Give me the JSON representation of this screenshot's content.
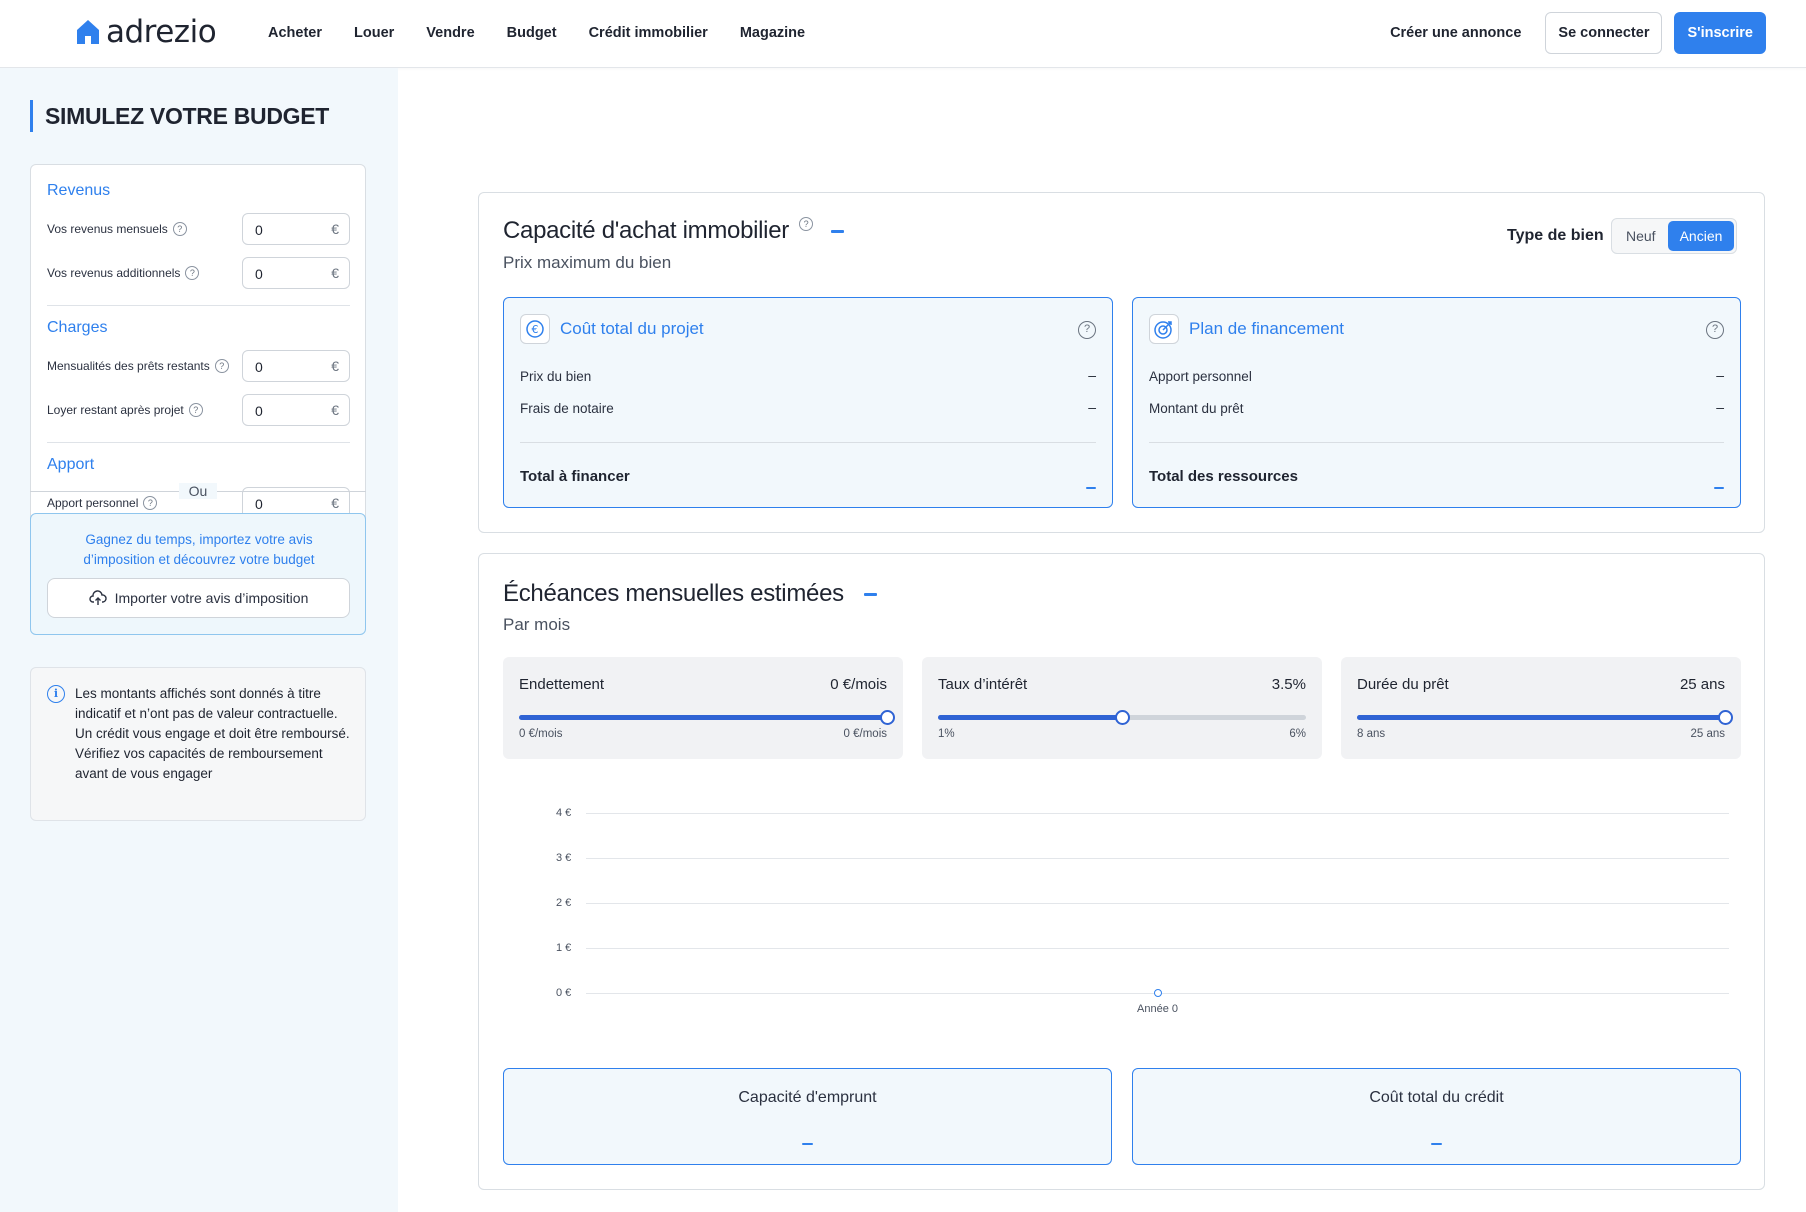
{
  "header": {
    "logo_text": "adrezio",
    "nav": [
      "Acheter",
      "Louer",
      "Vendre",
      "Budget",
      "Crédit immobilier",
      "Magazine"
    ],
    "create_listing": "Créer une annonce",
    "login": "Se connecter",
    "signup": "S'inscrire"
  },
  "sidebar": {
    "title": "SIMULEZ VOTRE BUDGET",
    "sections": {
      "revenus": "Revenus",
      "charges": "Charges",
      "apport": "Apport"
    },
    "fields": {
      "revenus_mensuels": {
        "label": "Vos revenus mensuels",
        "value": "0",
        "currency": "€"
      },
      "revenus_additionnels": {
        "label": "Vos revenus additionnels",
        "value": "0",
        "currency": "€"
      },
      "mensualites": {
        "label": "Mensualités des prêts restants",
        "value": "0",
        "currency": "€"
      },
      "loyer": {
        "label": "Loyer restant après projet",
        "value": "0",
        "currency": "€"
      },
      "apport_personnel": {
        "label": "Apport personnel",
        "value": "0",
        "currency": "€"
      }
    },
    "help_glyph": "?",
    "or_label": "Ou",
    "import_text": "Gagnez du temps, importez votre avis d’imposition et découvrez votre budget",
    "import_button": "Importer votre avis d’imposition",
    "info_glyph": "i",
    "info_text": "Les montants affichés sont donnés à titre indicatif et n’ont pas de valeur contractuelle. Un crédit vous engage et doit être remboursé. Vérifiez vos capacités de remboursement avant de vous engager"
  },
  "capacity": {
    "title": "Capacité d'achat immobilier",
    "subtitle": "Prix maximum du bien",
    "type_label": "Type de bien",
    "type_options": [
      "Neuf",
      "Ancien"
    ],
    "type_selected": "Ancien",
    "cost_card": {
      "title": "Coût total du projet",
      "rows": [
        {
          "label": "Prix du bien",
          "value": "–"
        },
        {
          "label": "Frais de notaire",
          "value": "–"
        }
      ],
      "total_label": "Total à financer"
    },
    "financing_card": {
      "title": "Plan de financement",
      "rows": [
        {
          "label": "Apport personnel",
          "value": "–"
        },
        {
          "label": "Montant du prêt",
          "value": "–"
        }
      ],
      "total_label": "Total des ressources"
    }
  },
  "monthly": {
    "title": "Échéances mensuelles estimées",
    "subtitle": "Par mois",
    "sliders": [
      {
        "name": "Endettement",
        "value_text": "0 €/mois",
        "min": "0 €/mois",
        "max": "0 €/mois",
        "fraction": 1.0
      },
      {
        "name": "Taux d’intérêt",
        "value_text": "3.5%",
        "min": "1%",
        "max": "6%",
        "fraction": 0.5
      },
      {
        "name": "Durée du prêt",
        "value_text": "25 ans",
        "min": "8 ans",
        "max": "25 ans",
        "fraction": 1.0
      }
    ],
    "results": {
      "borrowing_capacity": "Capacité d'emprunt",
      "total_credit_cost": "Coût total du crédit"
    }
  },
  "chart_data": {
    "type": "line",
    "title": "",
    "xlabel": "",
    "ylabel": "",
    "y_ticks": [
      "4 €",
      "3 €",
      "2 €",
      "1 €",
      "0 €"
    ],
    "ylim": [
      0,
      4
    ],
    "categories": [
      "Année 0"
    ],
    "series": [
      {
        "values": [
          0
        ]
      }
    ],
    "grid": true
  },
  "colors": {
    "accent": "#2f80ed",
    "slider": "#2f63d4"
  }
}
